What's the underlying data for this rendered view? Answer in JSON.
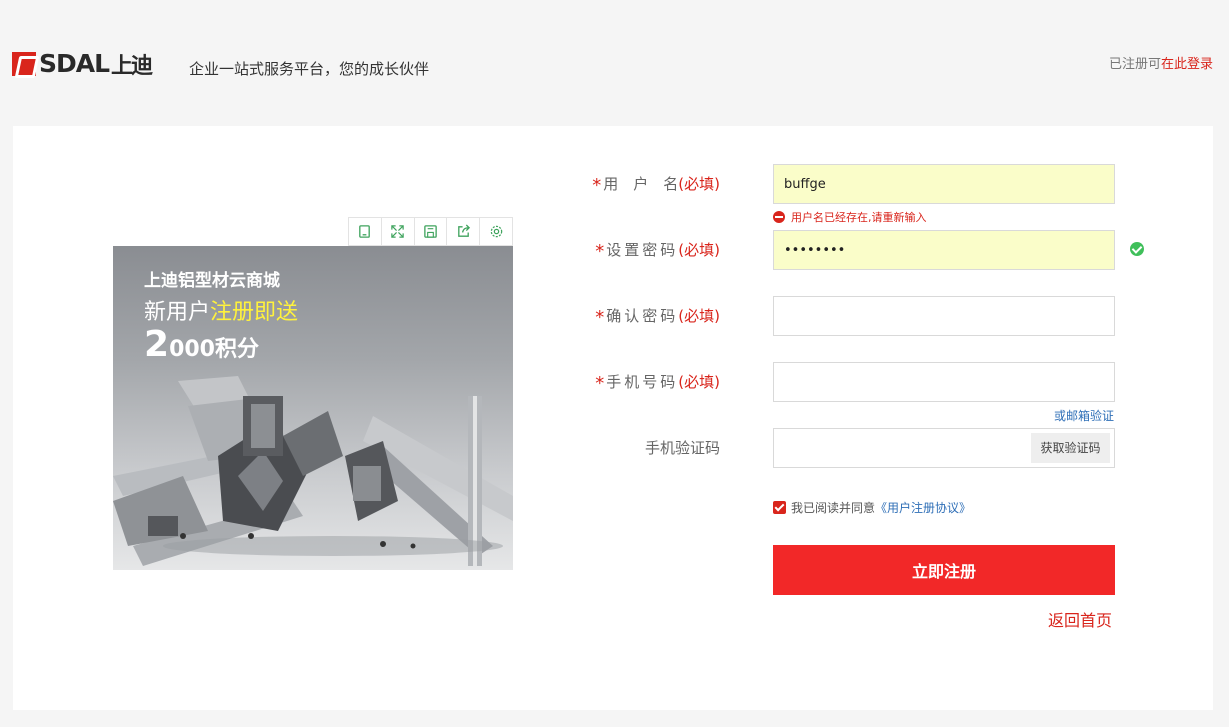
{
  "header": {
    "logo_text": "SDAL",
    "logo_cn": "上迪",
    "slogan": "企业一站式服务平台，您的成长伙伴",
    "login_prefix": "已注册可",
    "login_link": "在此登录"
  },
  "toolbar": {
    "icons": [
      "mobile-icon",
      "fullscreen-icon",
      "save-icon",
      "share-icon",
      "settings-icon"
    ]
  },
  "banner": {
    "title": "上迪铝型材云商城",
    "line2_prefix": "新用户",
    "line2_highlight": "注册即送",
    "line3_big": "2",
    "line3_rest": "000积分"
  },
  "form": {
    "username": {
      "label": "用　户　名",
      "required": "(必填)",
      "value": "buffge"
    },
    "username_error": "用户名已经存在,请重新输入",
    "password": {
      "label": "设置密码",
      "required": "(必填)",
      "value": "••••••••"
    },
    "confirm": {
      "label": "确认密码",
      "required": "(必填)",
      "value": ""
    },
    "phone": {
      "label": "手机号码",
      "required": "(必填)",
      "value": ""
    },
    "email_verify": "或邮箱验证",
    "sms_code": {
      "label": "手机验证码",
      "value": ""
    },
    "get_code": "获取验证码",
    "agree_text": "我已阅读并同意",
    "agree_link": "《用户注册协议》",
    "submit": "立即注册",
    "back_home": "返回首页"
  },
  "colors": {
    "brand_red": "#d9251c",
    "submit_red": "#f22828",
    "link_blue": "#2f6fb7",
    "autofill_yellow": "#fafdc9",
    "success_green": "#3fbf5a"
  }
}
